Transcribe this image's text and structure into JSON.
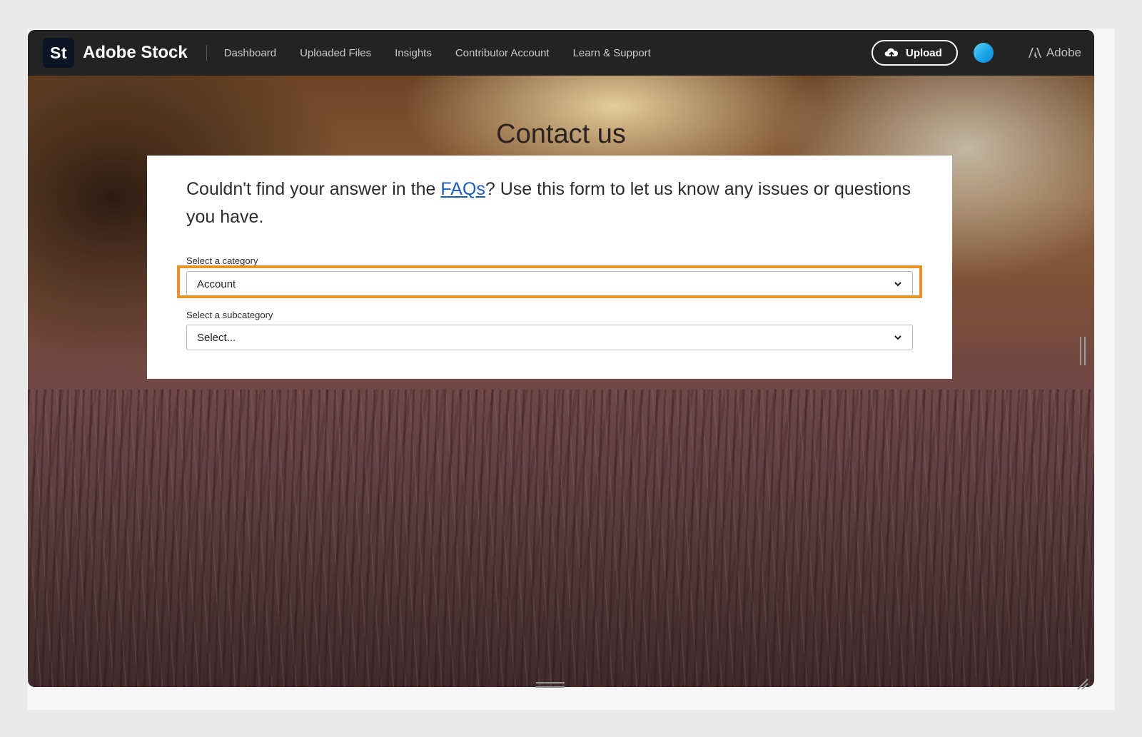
{
  "header": {
    "logo_text": "St",
    "brand": "Adobe Stock",
    "nav": [
      "Dashboard",
      "Uploaded Files",
      "Insights",
      "Contributor Account",
      "Learn & Support"
    ],
    "upload_label": "Upload",
    "adobe_label": "Adobe"
  },
  "main": {
    "title": "Contact us",
    "intro_before": "Couldn't find your answer in the ",
    "intro_link": "FAQs",
    "intro_after": "? Use this form to let us know any issues or questions you have.",
    "category_label": "Select a category",
    "category_value": "Account",
    "subcategory_label": "Select a subcategory",
    "subcategory_value": "Select..."
  },
  "colors": {
    "highlight": "#e8932a",
    "link": "#1a5bbf",
    "header_bg": "#232323"
  },
  "icons": [
    "upload-cloud-icon",
    "chevron-down-icon",
    "adobe-logo-icon"
  ]
}
